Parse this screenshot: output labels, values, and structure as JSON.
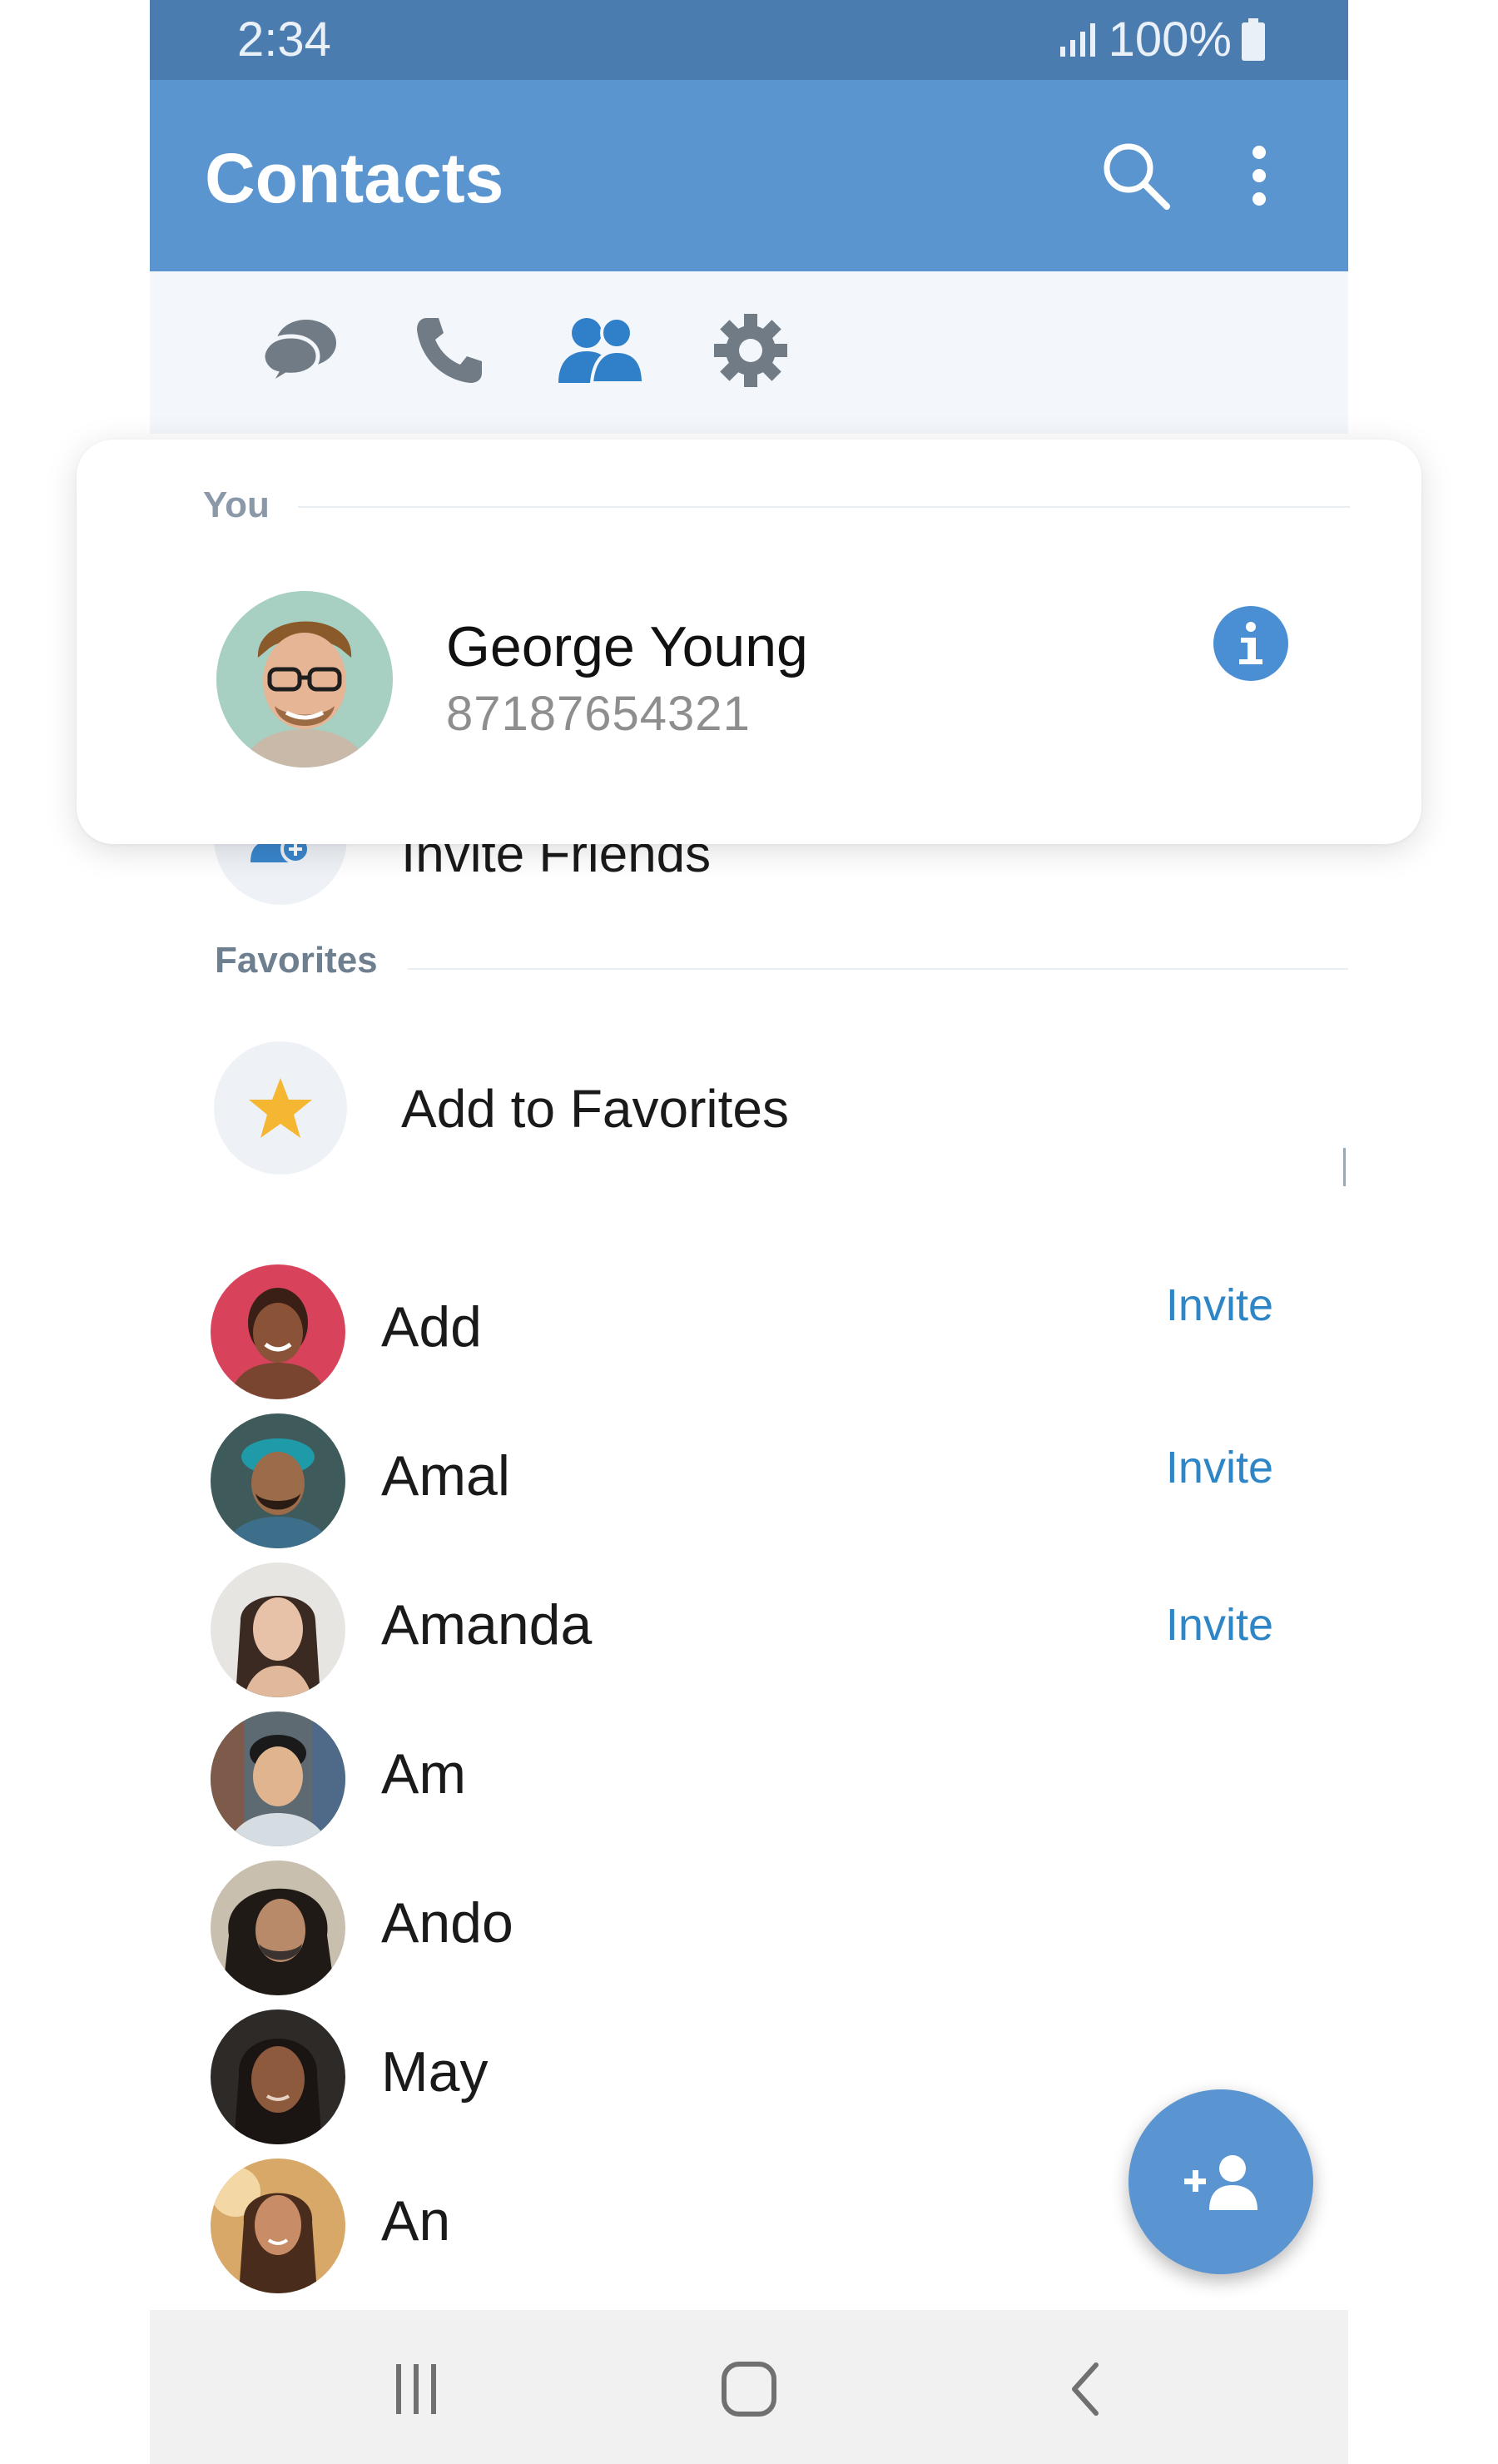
{
  "status_bar": {
    "time": "2:34",
    "battery": "100%"
  },
  "app_bar": {
    "title": "Contacts"
  },
  "tabs": [
    {
      "name": "chats",
      "icon": "chat-bubbles-icon"
    },
    {
      "name": "calls",
      "icon": "phone-icon"
    },
    {
      "name": "contacts",
      "icon": "contacts-icon",
      "selected": true
    },
    {
      "name": "settings",
      "icon": "gear-icon"
    }
  ],
  "you": {
    "section_label": "You",
    "name": "George Young",
    "phone": "87187654321"
  },
  "actions": {
    "invite_friends": "Invite Friends",
    "favorites_header": "Favorites",
    "add_to_favorites": "Add to Favorites"
  },
  "contacts": [
    {
      "name": "Add",
      "invite": "Invite"
    },
    {
      "name": "Amal",
      "invite": "Invite"
    },
    {
      "name": "Amanda",
      "invite": "Invite"
    },
    {
      "name": "Am",
      "invite": ""
    },
    {
      "name": "Ando",
      "invite": ""
    },
    {
      "name": "May",
      "invite": ""
    },
    {
      "name": "An",
      "invite": ""
    }
  ],
  "colors": {
    "status_bar": "#4b7cb0",
    "app_bar": "#5a95d0",
    "accent": "#2f86c6",
    "selected_tab": "#2f80c8",
    "star": "#f5b731"
  }
}
